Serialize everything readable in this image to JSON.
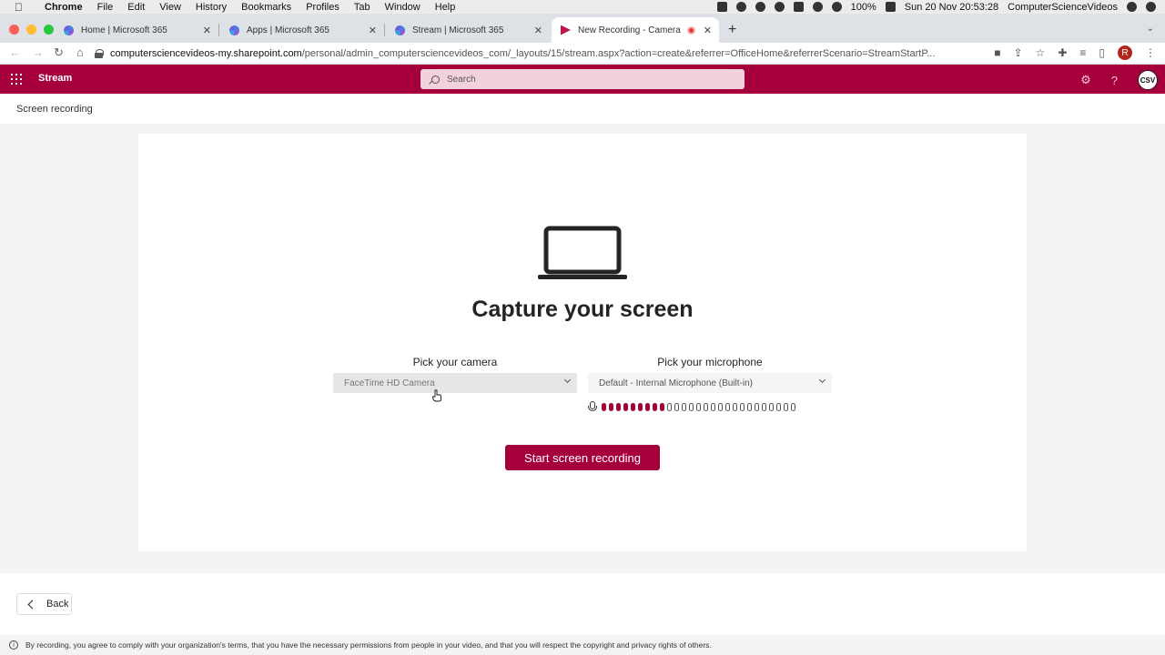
{
  "mac_menubar": {
    "items": [
      "Chrome",
      "File",
      "Edit",
      "View",
      "History",
      "Bookmarks",
      "Profiles",
      "Tab",
      "Window",
      "Help"
    ],
    "battery": "100%",
    "datetime": "Sun 20 Nov  20:53:28",
    "user": "ComputerScienceVideos"
  },
  "browser": {
    "tabs": [
      {
        "title": "Home | Microsoft 365"
      },
      {
        "title": "Apps | Microsoft 365"
      },
      {
        "title": "Stream | Microsoft 365"
      },
      {
        "title": "New Recording - Camera"
      }
    ],
    "url_host": "computersciencevideos-my.sharepoint.com",
    "url_path": "/personal/admin_computersciencevideos_com/_layouts/15/stream.aspx?action=create&referrer=OfficeHome&referrerScenario=StreamStartP...",
    "profile_initial": "R"
  },
  "app_header": {
    "title": "Stream",
    "search_placeholder": "Search",
    "avatar_text": "CSV"
  },
  "page": {
    "subheader": "Screen recording",
    "heading": "Capture your screen",
    "camera_label": "Pick your camera",
    "camera_value": "FaceTime HD Camera",
    "mic_label": "Pick your microphone",
    "mic_value": "Default - Internal Microphone (Built-in)",
    "mic_level": {
      "active": 9,
      "total": 27
    },
    "start_button": "Start screen recording",
    "back_button": "Back",
    "disclaimer": "By recording, you agree to comply with your organization's terms, that you have the necessary permissions from people in your video, and that you will respect the copyright and privacy rights of others."
  },
  "colors": {
    "brand": "#a5003c",
    "search_bg": "#f2d1dc"
  }
}
